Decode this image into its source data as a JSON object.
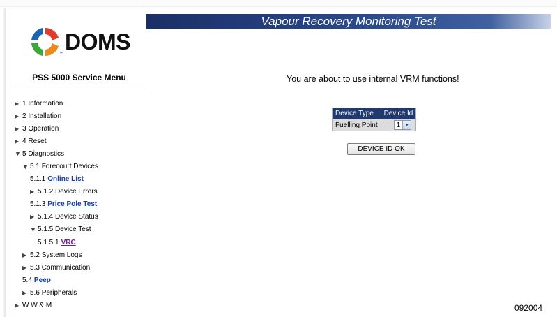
{
  "logo": {
    "text": "DOMS",
    "tm": "™"
  },
  "sidebar": {
    "title": "PSS 5000 Service Menu",
    "items": [
      {
        "num": "1",
        "label": "Information"
      },
      {
        "num": "2",
        "label": "Installation"
      },
      {
        "num": "3",
        "label": "Operation"
      },
      {
        "num": "4",
        "label": "Reset"
      },
      {
        "num": "5",
        "label": "Diagnostics"
      },
      {
        "num": "5.1",
        "label": "Forecourt Devices"
      },
      {
        "num": "5.1.1",
        "label": "Online List"
      },
      {
        "num": "5.1.2",
        "label": "Device Errors"
      },
      {
        "num": "5.1.3",
        "label": "Price Pole Test"
      },
      {
        "num": "5.1.4",
        "label": "Device Status"
      },
      {
        "num": "5.1.5",
        "label": "Device Test"
      },
      {
        "num": "5.1.5.1",
        "label": "VRC"
      },
      {
        "num": "5.2",
        "label": "System Logs"
      },
      {
        "num": "5.3",
        "label": "Communication"
      },
      {
        "num": "5.4",
        "label": "Peep"
      },
      {
        "num": "5.6",
        "label": "Peripherals"
      },
      {
        "num": "W W & M",
        "label": ""
      }
    ]
  },
  "header": {
    "title": "Vapour Recovery Monitoring Test"
  },
  "main": {
    "intro": "You are about to use internal VRM functions!",
    "table": {
      "headers": [
        "Device Type",
        "Device Id"
      ],
      "row": {
        "type": "Fuelling Point",
        "id_value": "1"
      }
    },
    "ok_button": "DEVICE ID OK"
  },
  "figure_id": "092004",
  "colors": {
    "header_bg": "#1b2f66",
    "link": "#1a3ea8",
    "link_visited": "#7a1aa0",
    "table_header": "#1f3a73"
  },
  "icons": {
    "collapsed": "triangle-right-icon",
    "expanded": "triangle-down-icon",
    "select": "chevron-down-icon"
  }
}
